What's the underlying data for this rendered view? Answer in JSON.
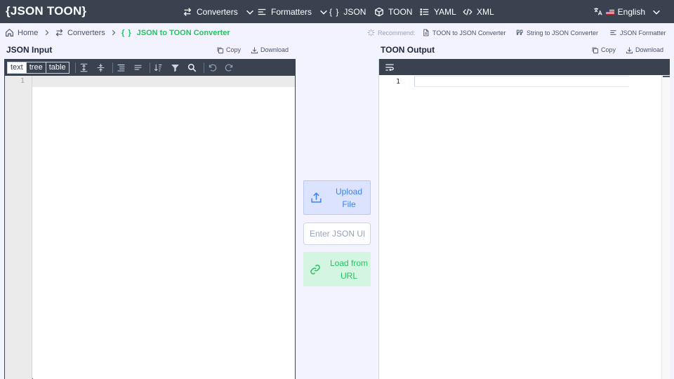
{
  "header": {
    "brand": "{JSON TOON}",
    "nav": [
      {
        "label": "Converters",
        "icon": "arrows-swap-icon",
        "has_dropdown": true
      },
      {
        "label": "Formatters",
        "icon": "align-left-icon",
        "has_dropdown": true
      },
      {
        "label": "JSON",
        "icon": "braces-icon",
        "has_dropdown": false
      },
      {
        "label": "TOON",
        "icon": "cube-icon",
        "has_dropdown": false
      },
      {
        "label": "YAML",
        "icon": "list-icon",
        "has_dropdown": false
      },
      {
        "label": "XML",
        "icon": "code-icon",
        "has_dropdown": false
      }
    ],
    "language": "English"
  },
  "breadcrumb": {
    "items": [
      {
        "label": "Home",
        "icon": "home-icon"
      },
      {
        "label": "Converters",
        "icon": "arrows-swap-icon"
      },
      {
        "label": "JSON to TOON Converter",
        "icon": "braces-icon"
      }
    ],
    "recommend_label": "Recommend:",
    "recommend": [
      {
        "label": "TOON to JSON Converter",
        "icon": "file-icon"
      },
      {
        "label": "String to JSON Converter",
        "icon": "quote-icon"
      },
      {
        "label": "JSON Formatter",
        "icon": "align-left-icon"
      }
    ]
  },
  "input_panel": {
    "title": "JSON Input",
    "copy": "Copy",
    "download": "Download",
    "modes": [
      "text",
      "tree",
      "table"
    ],
    "active_mode": "text",
    "line_number": "1"
  },
  "middle": {
    "upload": "Upload File",
    "url_placeholder": "Enter JSON URL",
    "load": "Load from URL"
  },
  "output_panel": {
    "title": "TOON Output",
    "copy": "Copy",
    "download": "Download",
    "line_number": "1"
  },
  "colors": {
    "navbar": "#3a4250",
    "background": "#f3f2ff",
    "accent_green": "#22c55e",
    "accent_blue": "#3b82f6"
  }
}
